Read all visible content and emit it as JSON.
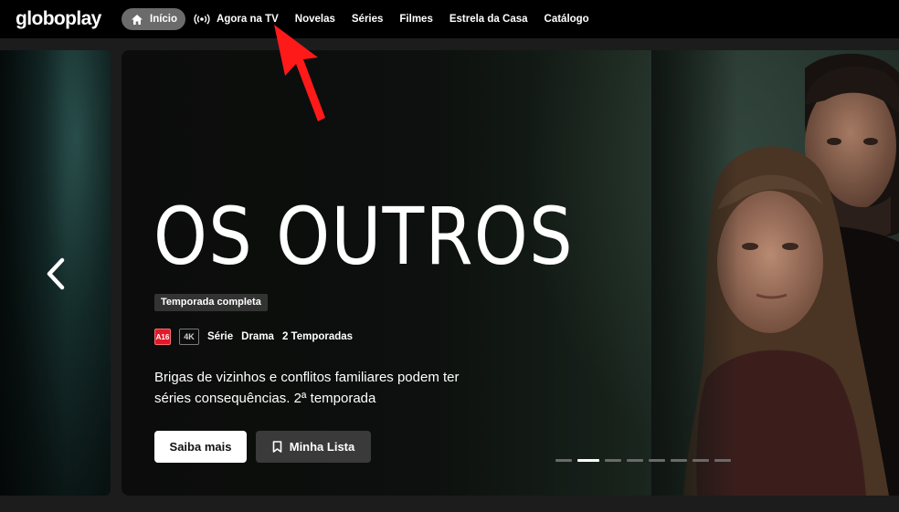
{
  "header": {
    "logo": "globoplay",
    "nav": [
      {
        "label": "Início",
        "icon": "home-icon",
        "active": true
      },
      {
        "label": "Agora na TV",
        "icon": "broadcast-icon"
      },
      {
        "label": "Novelas"
      },
      {
        "label": "Séries"
      },
      {
        "label": "Filmes"
      },
      {
        "label": "Estrela da Casa"
      },
      {
        "label": "Catálogo"
      }
    ]
  },
  "hero": {
    "title_logo": "OS OUTROS",
    "badge": "Temporada completa",
    "rating": "A16",
    "quality": "4K",
    "genre_type": "Série",
    "genre": "Drama",
    "seasons": "2 Temporadas",
    "synopsis": "Brigas de vizinhos e conflitos familiares podem ter séries consequências. 2ª temporada",
    "primary_button": "Saiba mais",
    "secondary_button": "Minha Lista",
    "secondary_icon": "bookmark-icon",
    "carousel": {
      "total_slides": 8,
      "active_index": 1
    }
  },
  "colors": {
    "nav_background": "#000000",
    "active_pill": "#6b6b6b",
    "rating_red": "#e4172b",
    "annotation_arrow": "#ff1a1a"
  }
}
